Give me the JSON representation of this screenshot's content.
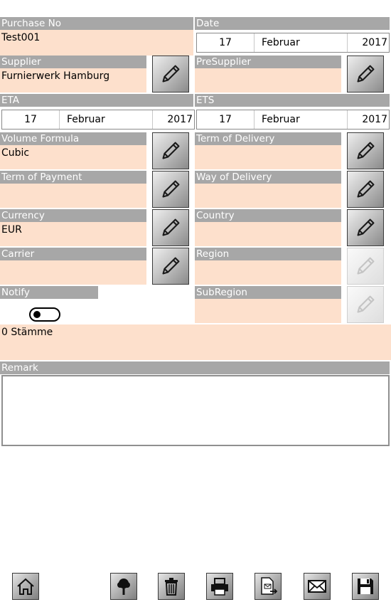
{
  "purchase_no": {
    "label": "Purchase No",
    "value": "Test001"
  },
  "date": {
    "label": "Date",
    "day": "17",
    "month": "Februar",
    "year": "2017"
  },
  "supplier": {
    "label": "Supplier",
    "value": "Furnierwerk Hamburg"
  },
  "presupplier": {
    "label": "PreSupplier",
    "value": ""
  },
  "eta": {
    "label": "ETA",
    "day": "17",
    "month": "Februar",
    "year": "2017"
  },
  "ets": {
    "label": "ETS",
    "day": "17",
    "month": "Februar",
    "year": "2017"
  },
  "volume_formula": {
    "label": "Volume Formula",
    "value": "Cubic"
  },
  "term_of_delivery": {
    "label": "Term of Delivery",
    "value": ""
  },
  "term_of_payment": {
    "label": "Term of Payment",
    "value": ""
  },
  "way_of_delivery": {
    "label": "Way of Delivery",
    "value": ""
  },
  "currency": {
    "label": "Currency",
    "value": "EUR"
  },
  "country": {
    "label": "Country",
    "value": ""
  },
  "carrier": {
    "label": "Carrier",
    "value": ""
  },
  "region": {
    "label": "Region",
    "value": ""
  },
  "notify": {
    "label": "Notify",
    "toggle_on": false
  },
  "subregion": {
    "label": "SubRegion",
    "value": ""
  },
  "stems": {
    "value": "0 Stämme"
  },
  "remark": {
    "label": "Remark",
    "value": ""
  },
  "toolbar": {
    "buttons": [
      {
        "icon": "home-icon"
      },
      {
        "icon": "tree-icon"
      },
      {
        "icon": "trash-icon"
      },
      {
        "icon": "print-icon"
      },
      {
        "icon": "export-document-icon"
      },
      {
        "icon": "mail-icon"
      },
      {
        "icon": "save-icon"
      }
    ]
  },
  "colors": {
    "header_bg": "#a7a7a7",
    "header_text": "#ffffff",
    "field_bg": "#fde0cc",
    "border": "#8f8f8f"
  }
}
